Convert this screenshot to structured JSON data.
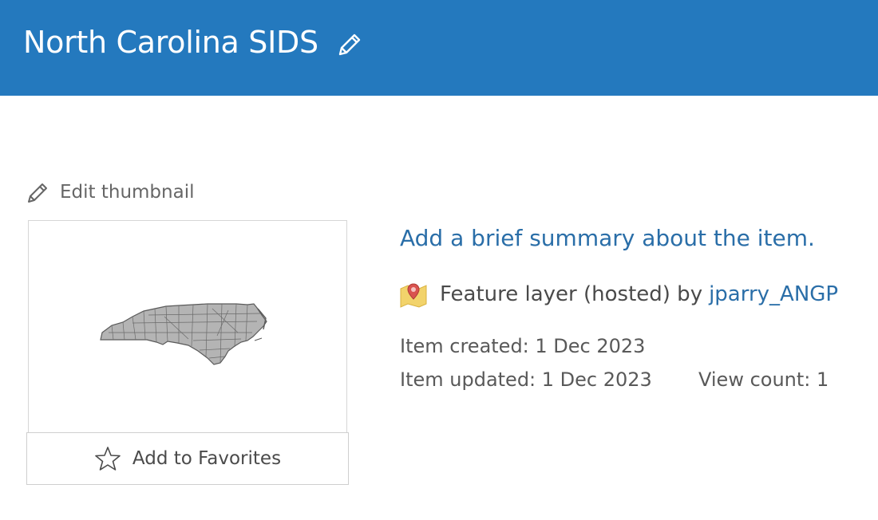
{
  "header": {
    "title": "North Carolina SIDS",
    "background_color": "#2479be",
    "edit_icon": "pencil-icon"
  },
  "thumbnail": {
    "edit_label": "Edit thumbnail",
    "edit_icon": "pencil-icon",
    "image_subject": "North Carolina counties map",
    "map_fill_color": "#b4b4b4",
    "map_stroke_color": "#5a5a5a"
  },
  "favorites": {
    "label": "Add to Favorites",
    "icon": "star-outline-icon"
  },
  "details": {
    "summary_placeholder": "Add a brief summary about the item.",
    "link_color": "#2a6ea8",
    "type_icon": "feature-layer-map-icon",
    "type_text": "Feature layer (hosted) by",
    "owner": "jparry_ANGP",
    "created": "Item created: 1 Dec 2023",
    "updated": "Item updated: 1 Dec 2023",
    "view_count": "View count: 1"
  }
}
